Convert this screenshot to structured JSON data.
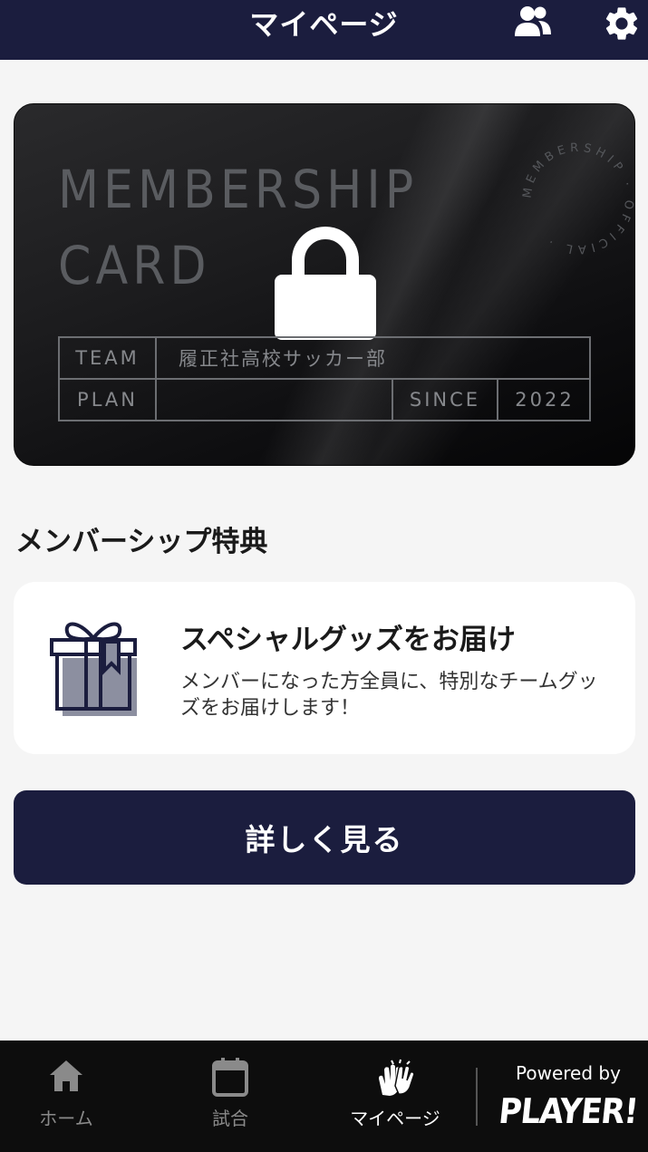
{
  "header": {
    "title": "マイページ",
    "icons": [
      "people-icon",
      "gear-icon"
    ]
  },
  "card": {
    "title": "MEMBERSHIP\nCARD",
    "seal_text": "MEMBERSHIP · OFFICIAL ·",
    "lock_icon": "lock-icon",
    "team_label": "TEAM",
    "team_value": "履正社高校サッカー部",
    "plan_label": "PLAN",
    "plan_value": "",
    "since_label": "SINCE",
    "since_value": "2022"
  },
  "section": {
    "title": "メンバーシップ特典"
  },
  "perk": {
    "icon": "gift-icon",
    "title": "スペシャルグッズをお届け",
    "description": "メンバーになった方全員に、特別なチームグッズをお届けします！"
  },
  "detail_button": {
    "label": "詳しく見る"
  },
  "bottom_nav": {
    "items": [
      {
        "label": "ホーム",
        "icon": "home-icon",
        "active": false
      },
      {
        "label": "試合",
        "icon": "calendar-icon",
        "active": false
      },
      {
        "label": "マイページ",
        "icon": "hands-icon",
        "active": true
      }
    ],
    "powered_by": "Powered by",
    "brand": "PLAYER!"
  },
  "colors": {
    "navy": "#1b1d3e",
    "nav_bg": "#0d0d0d",
    "inactive": "#8a8a8a",
    "active": "#ffffff"
  }
}
